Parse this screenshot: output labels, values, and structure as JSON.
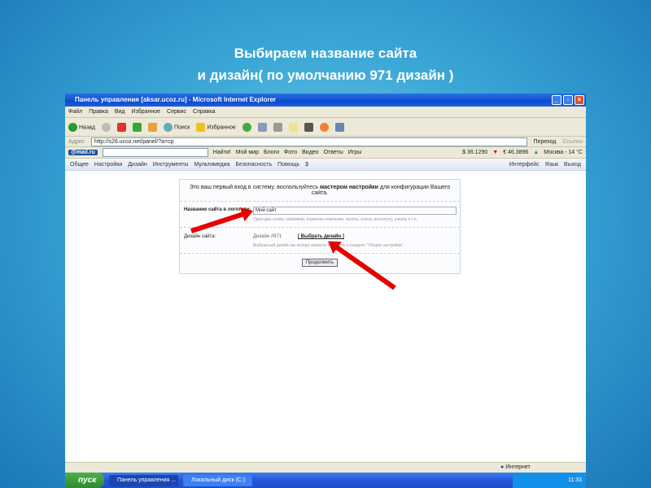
{
  "slide": {
    "title_line1": "Выбираем название сайта",
    "title_line2": "и дизайн( по умолчанию 971 дизайн )"
  },
  "window": {
    "title": "Панель управления [aksar.ucoz.ru] - Microsoft Internet Explorer"
  },
  "menu": [
    "Файл",
    "Правка",
    "Вид",
    "Избранное",
    "Сервис",
    "Справка"
  ],
  "toolbar": {
    "back": "Назад",
    "search": "Поиск",
    "favorites": "Избранное"
  },
  "address": {
    "label": "Адрес",
    "url": "http://s26.ucoz.net/panel/?a=cp",
    "go": "Переход",
    "links": "Ссылки"
  },
  "mailbar": {
    "logo": "@mail.ru",
    "find": "Найти!",
    "items": [
      "Мой мир",
      "Блоги",
      "Фото",
      "Видео",
      "Ответы",
      "Игры"
    ],
    "usd": "$ 36.1290",
    "eur": "€ 46.3896",
    "weather": "Москва - 14 °C"
  },
  "ucoz_nav": {
    "items": [
      "Общее",
      "Настройки",
      "Дизайн",
      "Инструменты",
      "Мультимедиа",
      "Безопасность",
      "Помощь",
      "$"
    ],
    "right": [
      "Интерфейс",
      "Язык",
      "Выход"
    ]
  },
  "wizard": {
    "intro_pre": "Это ваш первый вход в систему, воспользуйтесь ",
    "intro_bold": "мастером настройки",
    "intro_post": " для конфигурации Вашего сайта.",
    "name_label": "Название сайта в логотипе:",
    "name_value": "Мой сайт",
    "name_hint": "Одно-два слова, например, название компании, группы, клана, институту, школы и т.п.",
    "design_label": "Дизайн сайта:",
    "design_value": "Дизайн #971",
    "design_link": "[ Выбрать дизайн ]",
    "design_hint": "Выбранный дизайн вы всегда сможете поменять в разделе \"Общие настройки\".",
    "continue": "Продолжить"
  },
  "status": {
    "zone": "Интернет"
  },
  "taskbar": {
    "start": "пуск",
    "tasks": [
      "Панель управления ...",
      "Локальный диск (C:)"
    ],
    "clock": "11:33"
  }
}
